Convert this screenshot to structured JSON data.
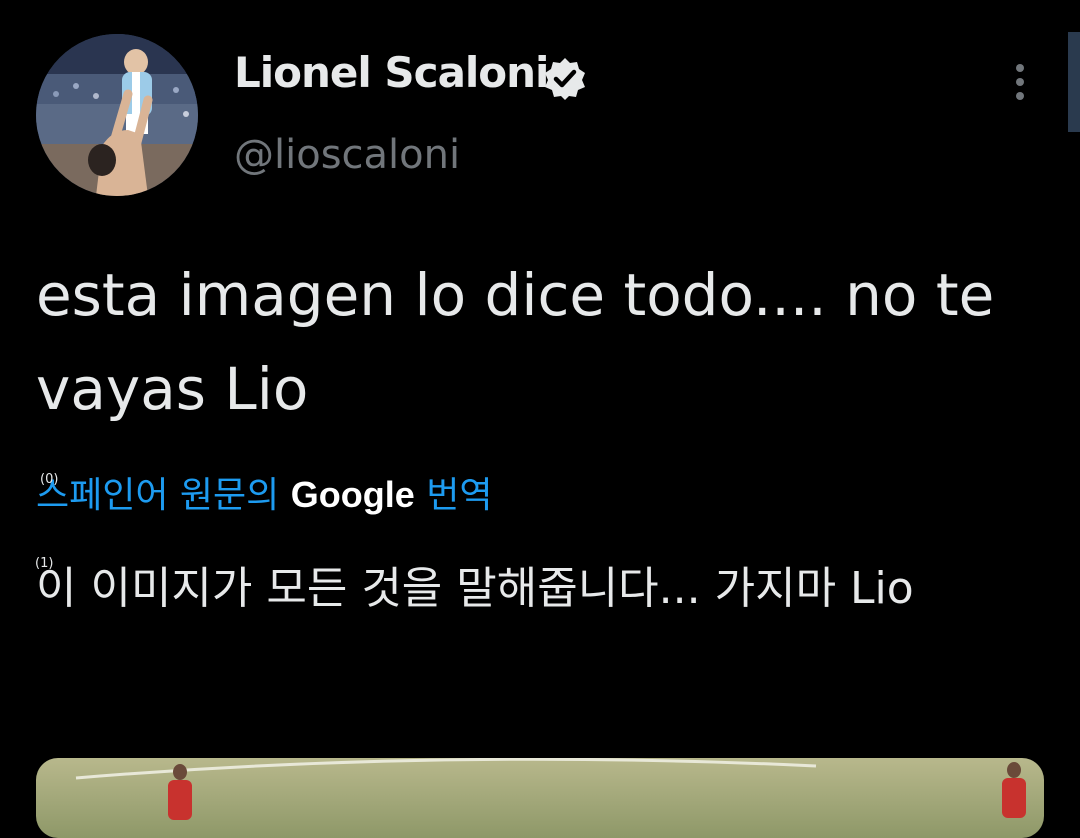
{
  "tweet": {
    "author": {
      "name": "Lionel Scaloni",
      "handle": "@lioscaloni",
      "verified": true,
      "verified_icon": "verified-badge-icon"
    },
    "more_icon": "more-vertical-icon",
    "text": "esta imagen lo dice todo.... no te vayas Lio",
    "translation": {
      "link_prefix": "스페인어 원문의",
      "link_brand": "Google",
      "link_suffix": "번역",
      "text": "이 이미지가 모든 것을 말해줍니다... 가지마 Lio",
      "markers": [
        "(0)",
        "(1)"
      ]
    }
  },
  "colors": {
    "background": "#000000",
    "text_primary": "#e7e9ea",
    "text_secondary": "#71767b",
    "link": "#1d9bf0"
  }
}
